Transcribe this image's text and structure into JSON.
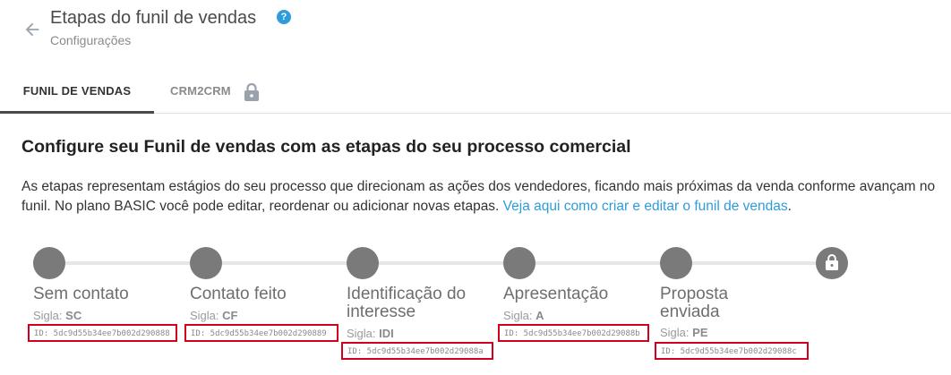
{
  "header": {
    "title": "Etapas do funil de vendas",
    "subtitle": "Configurações",
    "help_icon": "?"
  },
  "tabs": [
    {
      "label": "FUNIL DE VENDAS",
      "active": true
    },
    {
      "label": "CRM2CRM",
      "active": false,
      "locked": true
    }
  ],
  "content": {
    "title": "Configure seu Funil de vendas com as etapas do seu processo comercial",
    "description": "As etapas representam estágios do seu processo que direcionam as ações dos vendedores, ficando mais próximas da venda conforme avançam no funil. No plano BASIC você pode editar, reordenar ou adicionar novas etapas. ",
    "link_text": "Veja aqui como criar e editar o funil de vendas",
    "link_suffix": "."
  },
  "stages": [
    {
      "name_line1": "Sem contato",
      "name_line2": "",
      "sigla_label": "Sigla:",
      "sigla": "SC",
      "id": "ID: 5dc9d55b34ee7b002d290888"
    },
    {
      "name_line1": "Contato feito",
      "name_line2": "",
      "sigla_label": "Sigla:",
      "sigla": "CF",
      "id": "ID: 5dc9d55b34ee7b002d290889"
    },
    {
      "name_line1": "Identificação do",
      "name_line2": "interesse",
      "sigla_label": "Sigla:",
      "sigla": "IDI",
      "id": "ID: 5dc9d55b34ee7b002d29088a"
    },
    {
      "name_line1": "Apresentação",
      "name_line2": "",
      "sigla_label": "Sigla:",
      "sigla": "A",
      "id": "ID: 5dc9d55b34ee7b002d29088b"
    },
    {
      "name_line1": "Proposta",
      "name_line2": "enviada",
      "sigla_label": "Sigla:",
      "sigla": "PE",
      "id": "ID: 5dc9d55b34ee7b002d29088c"
    }
  ],
  "colors": {
    "accent": "#2d9cdb",
    "highlight_border": "#d0021b",
    "stage_dot": "#7a7a7a"
  }
}
